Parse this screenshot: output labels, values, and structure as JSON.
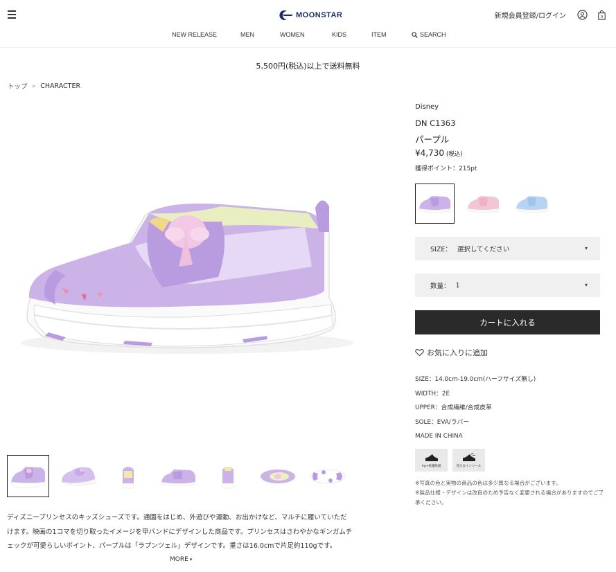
{
  "header": {
    "logo_text": "MOONSTAR",
    "account_link": "新規会員登録/ログイン",
    "cart_count": "0"
  },
  "nav": {
    "items": [
      "NEW RELEASE",
      "MEN",
      "WOMEN",
      "KIDS",
      "ITEM"
    ],
    "search_label": "SEARCH"
  },
  "banner": {
    "shipping": "5,500円(税込)以上で送料無料"
  },
  "breadcrumb": {
    "items": [
      "トップ",
      "CHARACTER"
    ],
    "separator": ">"
  },
  "product": {
    "brand": "Disney",
    "code": "DN C1363",
    "color_name": "パープル",
    "price": "¥4,730",
    "tax_note": "(税込)",
    "points": "獲得ポイント：215pt",
    "size_select": {
      "label": "SIZE：",
      "value": "選択してください"
    },
    "qty_select": {
      "label": "数量：",
      "value": "1"
    },
    "cart_button": "カートに入れる",
    "favorite": "お気に入りに追加",
    "specs": [
      "SIZE：14.0cm-19.0cm(ハーフサイズ無し)",
      "WIDTH：2E",
      "UPPER：合成繊維/合成皮革",
      "SOLE：EVA/ラバー",
      "MADE IN CHINA"
    ],
    "badges": [
      "Ag+抗菌防臭",
      "見えるインソール"
    ],
    "notes": [
      "※写真の色と実物の商品の色は多少異なる場合がございます。",
      "※製品仕様・デザインは改良のため予告なく変更される場合がありますのでご了承ください。"
    ],
    "description": "ディズニープリンセスのキッズシューズです。通園をはじめ、外遊びや運動、お出かけなど、マルチに履いていただけます。映画の1コマを切り取ったイメージを甲バンドにデザインした商品です。プリンセスはさわやかなギンガムチェックが可愛らしいポイント、パープルは「ラプンツェル」デザインです。重さは16.0cmで片足約110gです。",
    "more_label": "MORE"
  },
  "colors": {
    "accent": "#1b2a6b",
    "button": "#2a2a2a",
    "select_bg": "#f0f0f0"
  }
}
